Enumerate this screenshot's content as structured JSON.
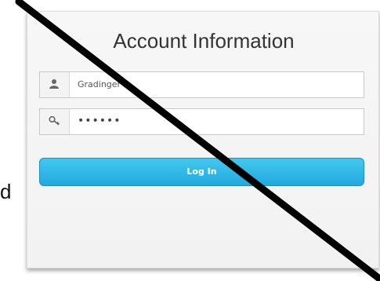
{
  "panel": {
    "title": "Account Information"
  },
  "username": {
    "value": "Gradinger",
    "icon": "user-icon"
  },
  "password": {
    "value": "••••••",
    "icon": "key-icon"
  },
  "login": {
    "label": "Log In"
  },
  "side_text": "d",
  "colors": {
    "accent": "#2bb3e6",
    "panel": "#f5f5f5",
    "strike": "#000000"
  }
}
